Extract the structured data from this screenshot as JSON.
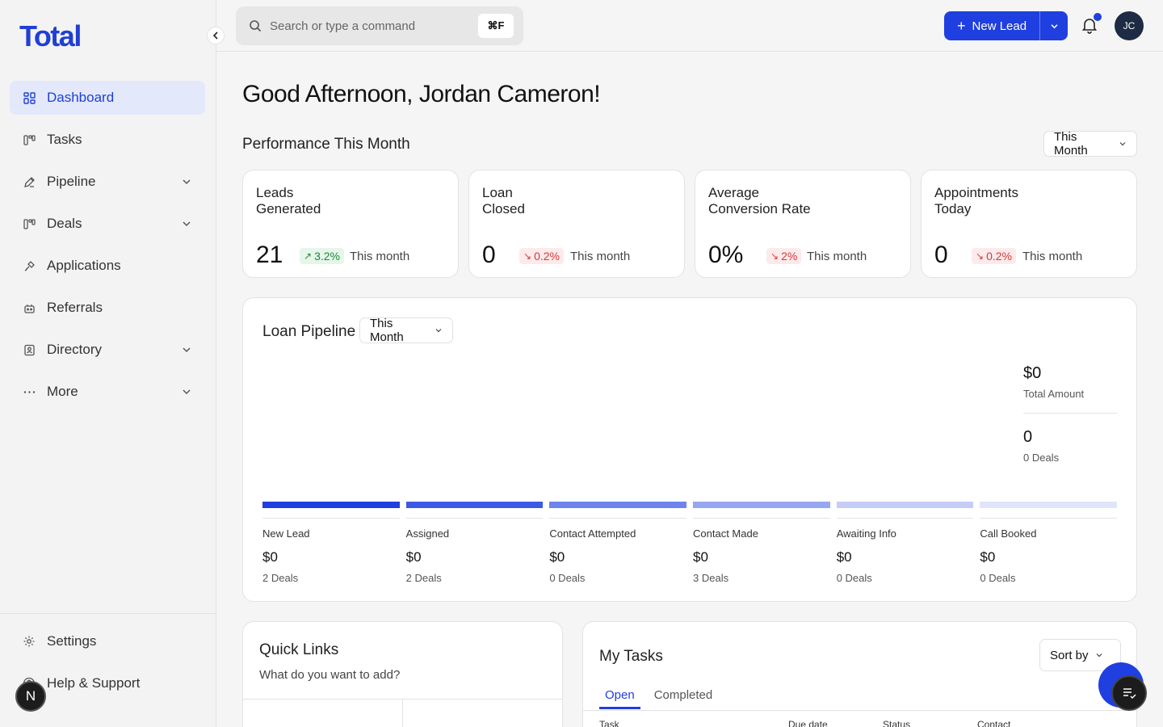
{
  "app": {
    "logo": "Total"
  },
  "sidebar": {
    "items": [
      {
        "label": "Dashboard",
        "icon": "dashboard-icon",
        "active": true,
        "has_chevron": false
      },
      {
        "label": "Tasks",
        "icon": "tasks-icon",
        "active": false,
        "has_chevron": false
      },
      {
        "label": "Pipeline",
        "icon": "pipeline-icon",
        "active": false,
        "has_chevron": true
      },
      {
        "label": "Deals",
        "icon": "deals-icon",
        "active": false,
        "has_chevron": true
      },
      {
        "label": "Applications",
        "icon": "applications-icon",
        "active": false,
        "has_chevron": false
      },
      {
        "label": "Referrals",
        "icon": "referrals-icon",
        "active": false,
        "has_chevron": false
      },
      {
        "label": "Directory",
        "icon": "directory-icon",
        "active": false,
        "has_chevron": true
      },
      {
        "label": "More",
        "icon": "more-icon",
        "active": false,
        "has_chevron": true
      }
    ],
    "bottom": [
      {
        "label": "Settings",
        "icon": "gear-icon"
      },
      {
        "label": "Help & Support",
        "icon": "help-icon"
      }
    ],
    "badge": "N"
  },
  "topbar": {
    "search_placeholder": "Search or type a command",
    "shortcut": "⌘F",
    "new_lead_label": "New Lead",
    "avatar_initials": "JC"
  },
  "main": {
    "greeting": "Good Afternoon, Jordan Cameron!",
    "performance_title": "Performance This Month",
    "performance_range": "This Month",
    "stats": [
      {
        "label_line1": "Leads",
        "label_line2": "Generated",
        "value": "21",
        "change": "3.2%",
        "trend": "up",
        "period": "This month"
      },
      {
        "label_line1": "Loan",
        "label_line2": "Closed",
        "value": "0",
        "change": "0.2%",
        "trend": "down",
        "period": "This month"
      },
      {
        "label_line1": "Average",
        "label_line2": "Conversion Rate",
        "value": "0%",
        "change": "2%",
        "trend": "down",
        "period": "This month"
      },
      {
        "label_line1": "Appointments",
        "label_line2": "Today",
        "value": "0",
        "change": "0.2%",
        "trend": "down",
        "period": "This month"
      }
    ],
    "pipeline": {
      "title": "Loan Pipeline",
      "range": "This Month",
      "total_amount": "$0",
      "total_amount_caption": "Total Amount",
      "total_deals": "0",
      "total_deals_caption": "0 Deals",
      "stages": [
        {
          "name": "New Lead",
          "amount": "$0",
          "deals": "2 Deals",
          "color": "#1f3fe0"
        },
        {
          "name": "Assigned",
          "amount": "$0",
          "deals": "2 Deals",
          "color": "#3d58e6"
        },
        {
          "name": "Contact Attempted",
          "amount": "$0",
          "deals": "0 Deals",
          "color": "#6e83ec"
        },
        {
          "name": "Contact Made",
          "amount": "$0",
          "deals": "3 Deals",
          "color": "#97a6f0"
        },
        {
          "name": "Awaiting Info",
          "amount": "$0",
          "deals": "0 Deals",
          "color": "#c5cdf6"
        },
        {
          "name": "Call Booked",
          "amount": "$0",
          "deals": "0 Deals",
          "color": "#e1e5fa"
        }
      ]
    },
    "quick_links": {
      "title": "Quick Links",
      "subtitle": "What do you want to add?"
    },
    "my_tasks": {
      "title": "My Tasks",
      "sort_label": "Sort by",
      "tabs": [
        "Open",
        "Completed"
      ],
      "columns": [
        "Task",
        "Due date",
        "Status",
        "Contact"
      ]
    }
  }
}
